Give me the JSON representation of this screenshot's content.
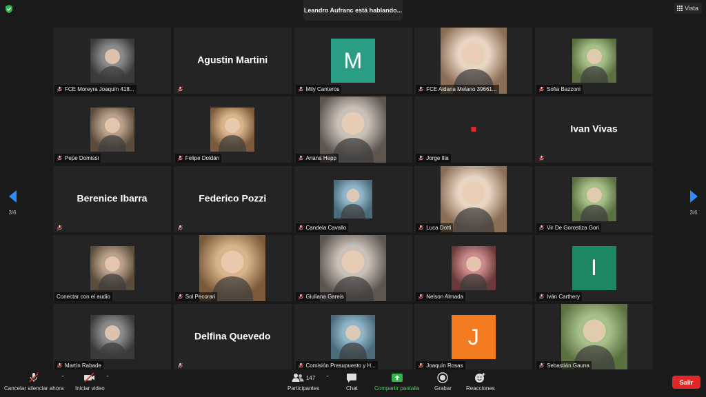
{
  "speaker_banner": "Leandro Aufranc está hablando...",
  "view_button": "Vista",
  "pagination": {
    "left": "3/6",
    "right": "3/6"
  },
  "colors": {
    "accent": "#2d8cff",
    "leave": "#e02828",
    "share": "#4cd15a",
    "teal": "#2b9d84",
    "green": "#1d8763",
    "orange": "#f47b20"
  },
  "tiles": [
    {
      "type": "photo",
      "name": "FCE Moreyra Joaquín 418..."
    },
    {
      "type": "text",
      "display": "Agustin Martini",
      "name": ""
    },
    {
      "type": "letter",
      "letter": "M",
      "color": "#2b9d84",
      "name": "Mily Canteros"
    },
    {
      "type": "photo-tall",
      "name": "FCE Aldana Melano 39661..."
    },
    {
      "type": "photo",
      "name": "Sofia Bazzoni"
    },
    {
      "type": "photo",
      "name": "Pepe Domissi"
    },
    {
      "type": "photo",
      "name": "Felipe Doldán"
    },
    {
      "type": "photo-tall",
      "name": "Ariana Hepp"
    },
    {
      "type": "dot",
      "name": "Jorge Illa"
    },
    {
      "type": "text",
      "display": "Ivan Vivas",
      "name": ""
    },
    {
      "type": "text",
      "display": "Berenice Ibarra",
      "name": ""
    },
    {
      "type": "text",
      "display": "Federico Pozzi",
      "name": ""
    },
    {
      "type": "photo-small",
      "name": "Candela Cavallo"
    },
    {
      "type": "photo-tall",
      "name": "Luca Dotti"
    },
    {
      "type": "photo",
      "name": "Vir De Gorostiza Gori"
    },
    {
      "type": "photo",
      "name": "Conectar con el audio",
      "no_mute": true
    },
    {
      "type": "photo-tall",
      "name": "Sol Pecorari"
    },
    {
      "type": "photo-tall",
      "name": "Giuliana Gareis"
    },
    {
      "type": "photo",
      "name": "Nelson Almada"
    },
    {
      "type": "letter",
      "letter": "I",
      "color": "#1d8763",
      "name": "Iván Carthery"
    },
    {
      "type": "photo",
      "name": "Martín Rabade"
    },
    {
      "type": "text",
      "display": "Delfina Quevedo",
      "name": ""
    },
    {
      "type": "photo",
      "name": "Comisión Presupuesto y H..."
    },
    {
      "type": "letter",
      "letter": "J",
      "color": "#f47b20",
      "name": "Joaquín Rosas"
    },
    {
      "type": "photo-tall",
      "name": "Sebastián Gauna"
    }
  ],
  "toolbar": {
    "unmute": "Cancelar silenciar ahora",
    "video": "Iniciar video",
    "participants": "Participantes",
    "participants_count": "147",
    "chat": "Chat",
    "share": "Compartir pantalla",
    "record": "Grabar",
    "reactions": "Reacciones",
    "leave": "Salir"
  }
}
